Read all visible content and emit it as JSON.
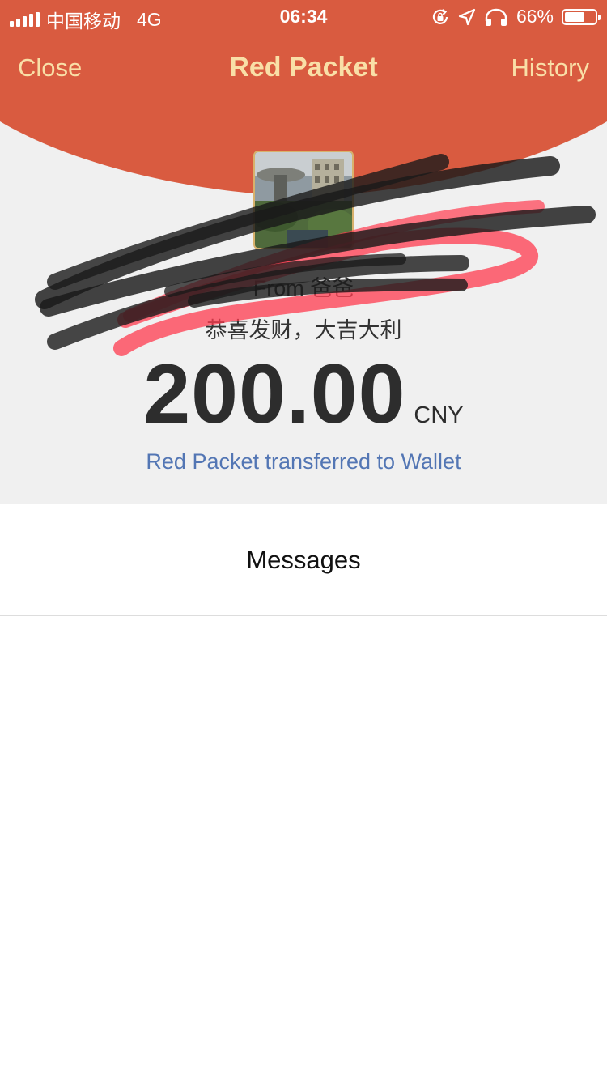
{
  "status_bar": {
    "carrier": "中国移动",
    "network": "4G",
    "time": "06:34",
    "battery": "66%",
    "battery_level": 0.66,
    "icons": [
      "signal-icon",
      "rotation-lock-icon",
      "location-arrow-icon",
      "headphones-icon",
      "battery-icon"
    ]
  },
  "nav": {
    "close_label": "Close",
    "title": "Red Packet",
    "history_label": "History"
  },
  "packet": {
    "from": "From 爸爸",
    "blessing": "恭喜发财，大吉大利",
    "amount": "200.00",
    "currency": "CNY",
    "wallet_link": "Red Packet transferred to Wallet"
  },
  "messages": {
    "title": "Messages"
  },
  "colors": {
    "header_red": "#d95b40",
    "nav_text_gold": "#f9dfa7",
    "link_blue": "#5376b4",
    "background_gray": "#f0f0f0"
  }
}
